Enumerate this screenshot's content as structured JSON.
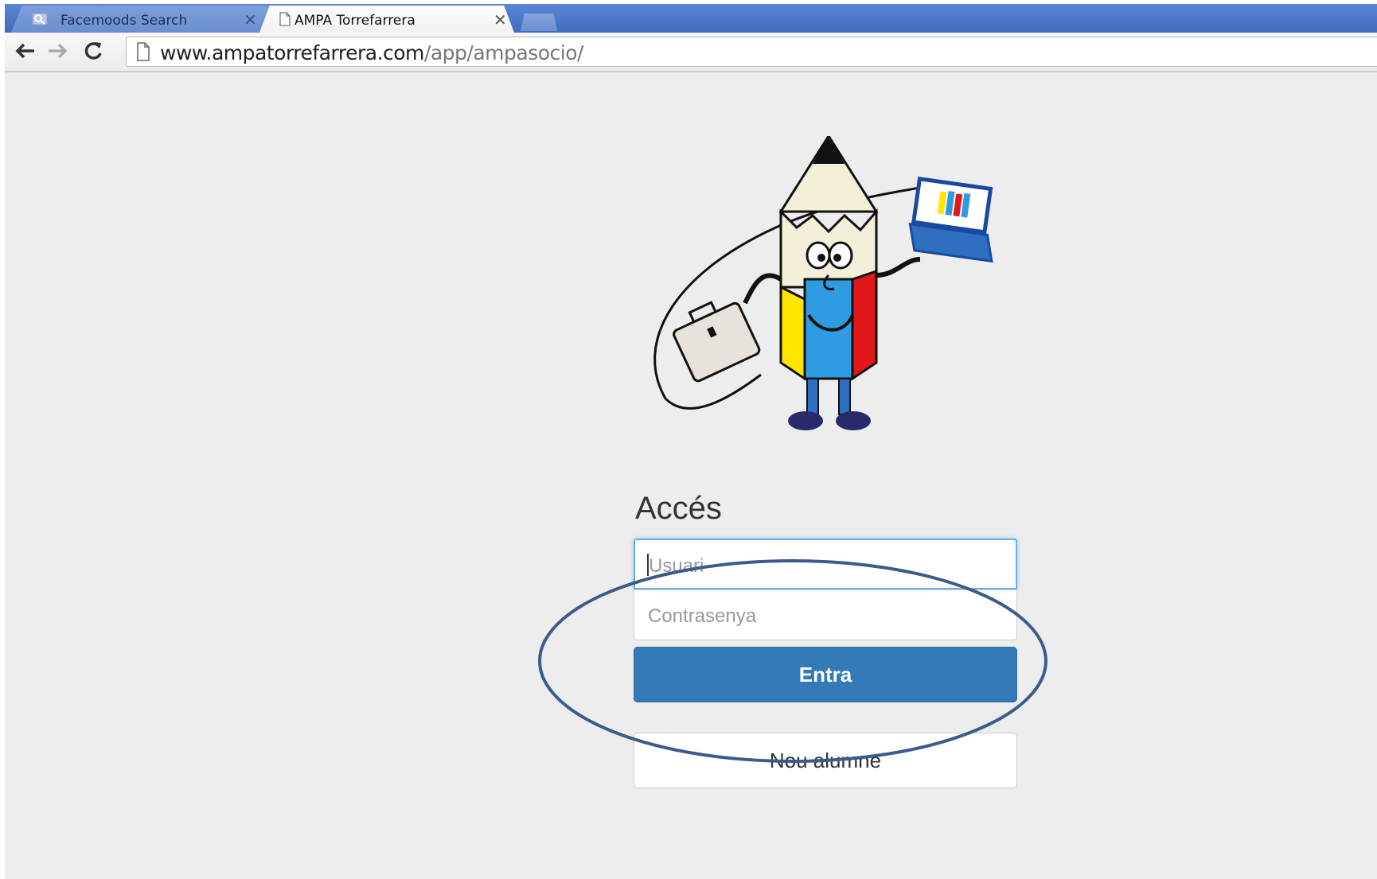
{
  "browser": {
    "tabs": [
      {
        "title": "Facemoods Search",
        "active": false
      },
      {
        "title": "AMPA Torrefarrera",
        "active": true
      }
    ],
    "url_host": "www.ampatorrefarrera.com",
    "url_path": "/app/ampasocio/"
  },
  "login": {
    "heading": "Accés",
    "username_placeholder": "Usuari",
    "password_placeholder": "Contrasenya",
    "submit_label": "Entra",
    "new_student_label": "Nou alumne"
  },
  "colors": {
    "primary": "#337ab7",
    "tabbar": "#4a78c8",
    "annotation": "#3b5b8c",
    "page_background": "#ededed"
  }
}
